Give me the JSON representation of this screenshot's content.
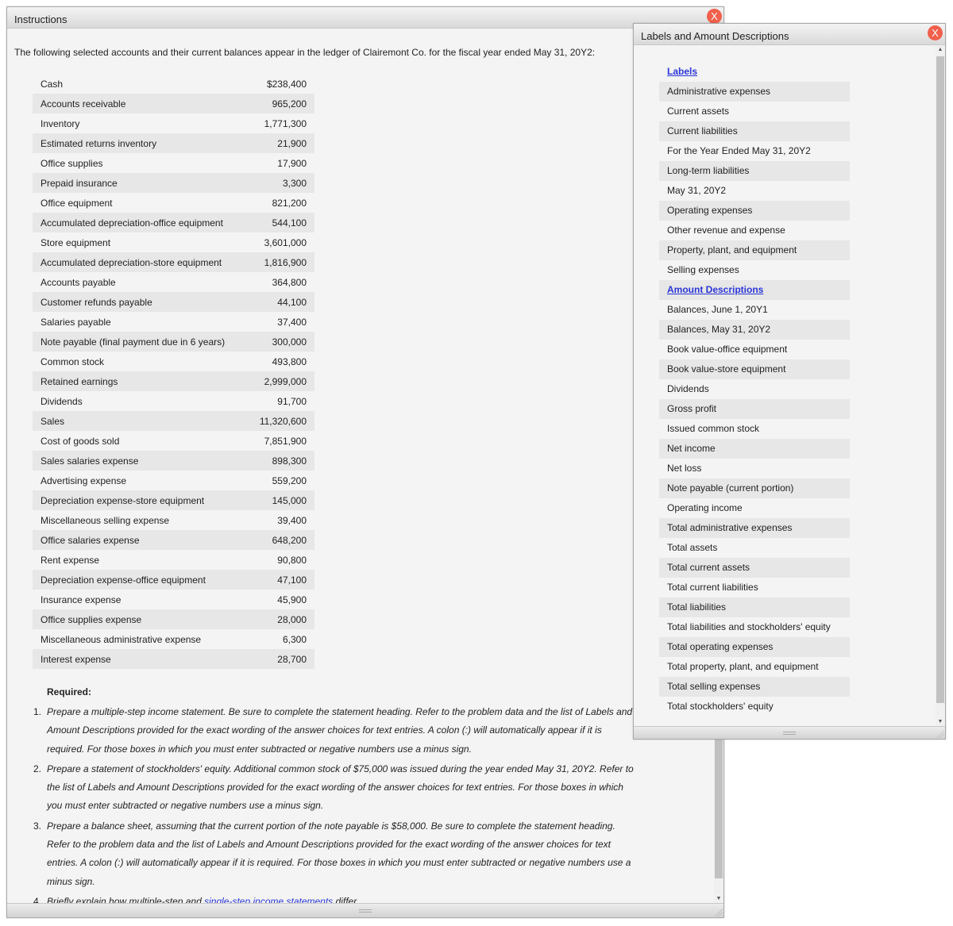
{
  "instructions": {
    "title": "Instructions",
    "intro": "The following selected accounts and their current balances appear in the ledger of Clairemont Co. for the fiscal year ended May 31, 20Y2:",
    "accounts": [
      {
        "name": "Cash",
        "value": "$238,400"
      },
      {
        "name": "Accounts receivable",
        "value": "965,200"
      },
      {
        "name": "Inventory",
        "value": "1,771,300"
      },
      {
        "name": "Estimated returns inventory",
        "value": "21,900"
      },
      {
        "name": "Office supplies",
        "value": "17,900"
      },
      {
        "name": "Prepaid insurance",
        "value": "3,300"
      },
      {
        "name": "Office equipment",
        "value": "821,200"
      },
      {
        "name": "Accumulated depreciation-office equipment",
        "value": "544,100"
      },
      {
        "name": "Store equipment",
        "value": "3,601,000"
      },
      {
        "name": "Accumulated depreciation-store equipment",
        "value": "1,816,900"
      },
      {
        "name": "Accounts payable",
        "value": "364,800"
      },
      {
        "name": "Customer refunds payable",
        "value": "44,100"
      },
      {
        "name": "Salaries payable",
        "value": "37,400"
      },
      {
        "name": "Note payable (final payment due in 6 years)",
        "value": "300,000"
      },
      {
        "name": "Common stock",
        "value": "493,800"
      },
      {
        "name": "Retained earnings",
        "value": "2,999,000"
      },
      {
        "name": "Dividends",
        "value": "91,700"
      },
      {
        "name": "Sales",
        "value": "11,320,600"
      },
      {
        "name": "Cost of goods sold",
        "value": "7,851,900"
      },
      {
        "name": "Sales salaries expense",
        "value": "898,300"
      },
      {
        "name": "Advertising expense",
        "value": "559,200"
      },
      {
        "name": "Depreciation expense-store equipment",
        "value": "145,000"
      },
      {
        "name": "Miscellaneous selling expense",
        "value": "39,400"
      },
      {
        "name": "Office salaries expense",
        "value": "648,200"
      },
      {
        "name": "Rent expense",
        "value": "90,800"
      },
      {
        "name": "Depreciation expense-office equipment",
        "value": "47,100"
      },
      {
        "name": "Insurance expense",
        "value": "45,900"
      },
      {
        "name": "Office supplies expense",
        "value": "28,000"
      },
      {
        "name": "Miscellaneous administrative expense",
        "value": "6,300"
      },
      {
        "name": "Interest expense",
        "value": "28,700"
      }
    ],
    "required_label": "Required:",
    "required": [
      {
        "num": "1.",
        "text": "Prepare a multiple-step income statement. Be sure to complete the statement heading. Refer to the problem data and the list of Labels and Amount Descriptions provided for the exact wording of the answer choices for text entries. A colon (:) will automatically appear if it is required. For those boxes in which you must enter subtracted or negative numbers use a minus sign."
      },
      {
        "num": "2.",
        "text": "Prepare a statement of stockholders' equity. Additional common stock of $75,000 was issued during the year ended May 31, 20Y2. Refer to the list of Labels and Amount Descriptions provided for the exact wording of the answer choices for text entries. For those boxes in which you must enter subtracted or negative numbers use a minus sign."
      },
      {
        "num": "3.",
        "text": "Prepare a balance sheet, assuming that the current portion of the note payable is $58,000. Be sure to complete the statement heading. Refer to the problem data and the list of Labels and Amount Descriptions provided for the exact wording of the answer choices for text entries. A colon (:) will automatically appear if it is required. For those boxes in which you must enter subtracted or negative numbers use a minus sign."
      }
    ],
    "item4": {
      "num": "4.",
      "before": "Briefly explain how multiple-step and ",
      "link": "single-step income statements",
      "after": " differ."
    },
    "close_label": "X"
  },
  "labels_window": {
    "title": "Labels and Amount Descriptions",
    "close_label": "X",
    "labels_heading": "Labels",
    "labels": [
      "Administrative expenses",
      "Current assets",
      "Current liabilities",
      "For the Year Ended May 31, 20Y2",
      "Long-term liabilities",
      "May 31, 20Y2",
      "Operating expenses",
      "Other revenue and expense",
      "Property, plant, and equipment",
      "Selling expenses"
    ],
    "amounts_heading": "Amount Descriptions",
    "amounts": [
      "Balances, June 1, 20Y1",
      "Balances, May 31, 20Y2",
      "Book value-office equipment",
      "Book value-store equipment",
      "Dividends",
      "Gross profit",
      "Issued common stock",
      "Net income",
      "Net loss",
      "Note payable (current portion)",
      "Operating income",
      "Total administrative expenses",
      "Total assets",
      "Total current assets",
      "Total current liabilities",
      "Total liabilities",
      "Total liabilities and stockholders' equity",
      "Total operating expenses",
      "Total property, plant, and equipment",
      "Total selling expenses",
      "Total stockholders' equity"
    ]
  }
}
